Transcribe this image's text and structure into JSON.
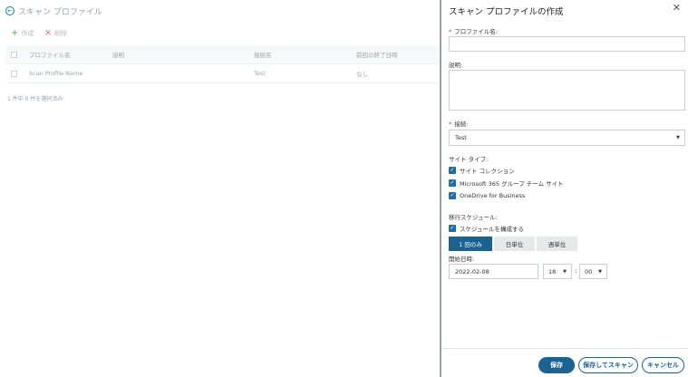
{
  "background": {
    "title": "スキャン プロファイル",
    "toolbar": {
      "create": "作成",
      "delete": "削除"
    },
    "table": {
      "headers": [
        "プロファイル名",
        "説明",
        "接続名",
        "前回の終了日時"
      ],
      "rows": [
        [
          "Scan Profile Name",
          "",
          "Test",
          "なし"
        ]
      ]
    },
    "selection_count": "1 件中 0 件を選択済み"
  },
  "panel": {
    "title": "スキャン プロファイルの作成",
    "profile_name": {
      "label": "プロファイル名:",
      "value": ""
    },
    "description": {
      "label": "説明:",
      "value": ""
    },
    "connection": {
      "label": "接続:",
      "value": "Test"
    },
    "site_type": {
      "label": "サイト タイプ:",
      "options": [
        "サイト コレクション",
        "Microsoft 365 グループ チーム サイト",
        "OneDrive for Business"
      ]
    },
    "schedule": {
      "label": "移行スケジュール:",
      "configure": "スケジュールを構成する",
      "freq": [
        "1 回のみ",
        "日単位",
        "週単位"
      ],
      "active_freq": "1 回のみ",
      "start_label": "開始日時:",
      "date": "2022-02-08",
      "hour": "18",
      "minute": "00",
      "separator": ":"
    },
    "buttons": {
      "save": "保存",
      "save_scan": "保存してスキャン",
      "cancel": "キャンセル"
    }
  },
  "colors": {
    "primary": "#1a6391",
    "checkbox": "#1e6fa8",
    "required": "#d32f2f"
  }
}
